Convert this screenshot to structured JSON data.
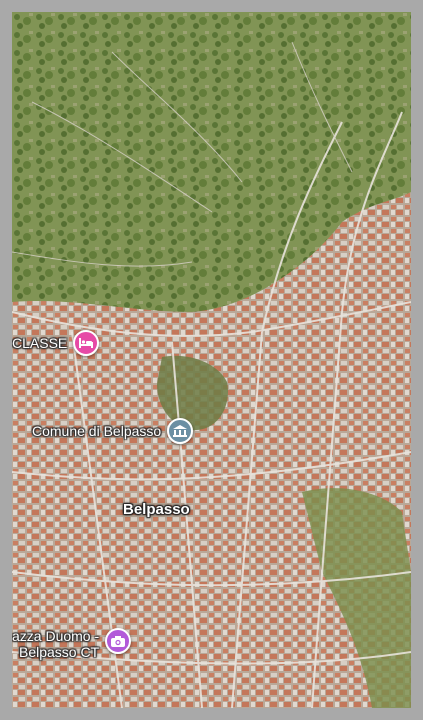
{
  "map": {
    "places": {
      "classe": {
        "label": "CLASSE",
        "icon": "hotel-bed-icon",
        "marker_color": "#e64aa6"
      },
      "comune": {
        "label": "Comune di Belpasso",
        "icon": "government-building-icon",
        "marker_color": "#6b8fa3"
      },
      "town": {
        "label": "Belpasso"
      },
      "piazza": {
        "line1": "azza Duomo -",
        "line2": "Belpasso CT",
        "icon": "camera-icon",
        "marker_color": "#b25ad9"
      }
    }
  }
}
